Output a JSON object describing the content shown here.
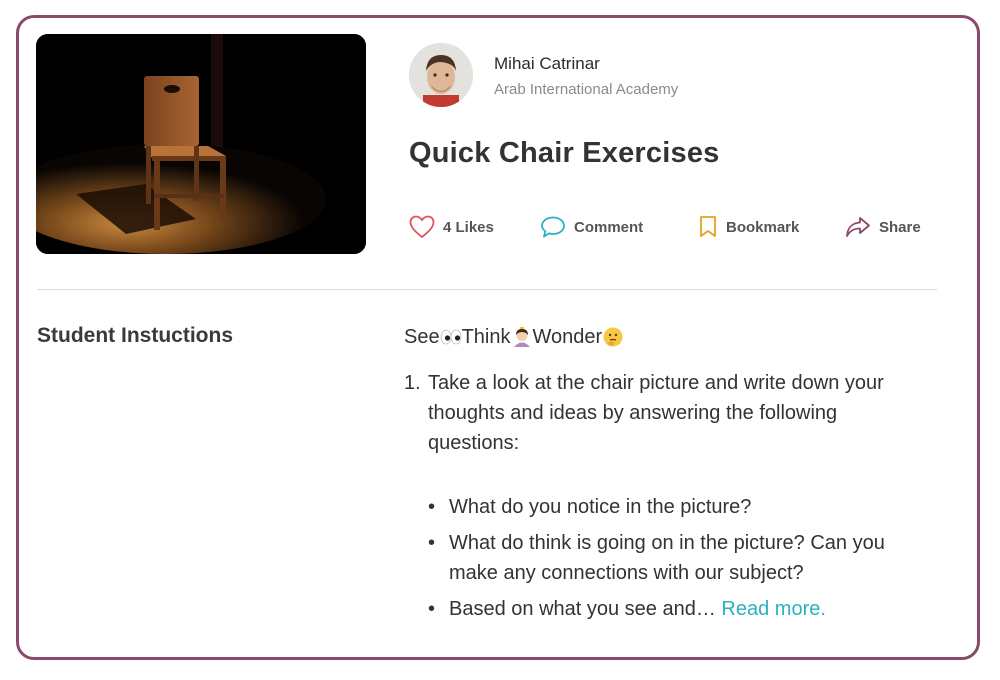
{
  "author": {
    "name": "Mihai Catrinar",
    "school": "Arab International Academy"
  },
  "post": {
    "title": "Quick Chair Exercises"
  },
  "actions": {
    "likes_label": "4 Likes",
    "comment_label": "Comment",
    "bookmark_label": "Bookmark",
    "share_label": "Share"
  },
  "section": {
    "label": "Student Instuctions"
  },
  "instructions": {
    "see": "See",
    "think": "Think",
    "wonder": "Wonder",
    "item_number": "1.",
    "item_text": "Take a look at the chair picture and write down your thoughts and ideas by answering the following questions:",
    "bullets": [
      "What do you notice in the picture?",
      "What do think is going on in the picture? Can you make any connections with our subject?",
      "Based on what you see and…"
    ],
    "read_more": "Read more."
  },
  "icons": {
    "heart": "heart-icon",
    "comment": "speech-bubble-icon",
    "bookmark": "bookmark-icon",
    "share": "share-arrow-icon",
    "eyes": "eyes-emoji",
    "thinking_person": "person-thinking-emoji",
    "thinking_face": "thinking-face-emoji"
  },
  "colors": {
    "border": "#8b4a6b",
    "heart": "#e0525d",
    "comment": "#2ab3bd",
    "bookmark": "#e8a020",
    "share": "#8b4a6b",
    "link": "#2ab3bd"
  }
}
